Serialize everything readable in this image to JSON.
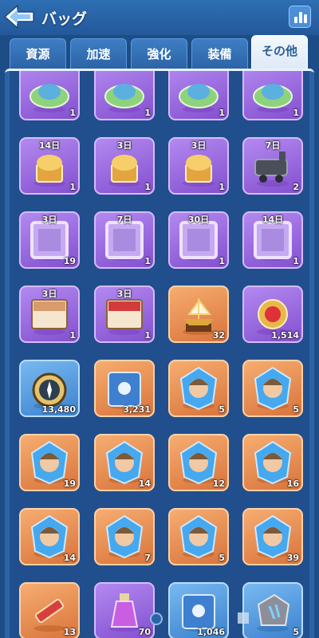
{
  "header": {
    "title": "バッグ",
    "back_icon": "arrow-left-icon",
    "stats_icon": "bar-chart-icon"
  },
  "tabs": [
    {
      "label": "資源",
      "active": false
    },
    {
      "label": "加速",
      "active": false
    },
    {
      "label": "強化",
      "active": false
    },
    {
      "label": "装備",
      "active": false
    },
    {
      "label": "その他",
      "active": true
    }
  ],
  "items": [
    {
      "name": "island-decor-1",
      "rarity": "purple",
      "count": "1",
      "days": ""
    },
    {
      "name": "island-decor-2",
      "rarity": "purple",
      "count": "1",
      "days": ""
    },
    {
      "name": "island-decor-3",
      "rarity": "purple",
      "count": "1",
      "days": ""
    },
    {
      "name": "island-decor-4",
      "rarity": "purple",
      "count": "1",
      "days": ""
    },
    {
      "name": "trophy-chest-1",
      "rarity": "purple",
      "count": "1",
      "days": "14日"
    },
    {
      "name": "trophy-chest-2",
      "rarity": "purple",
      "count": "1",
      "days": "3日"
    },
    {
      "name": "treasure-barrel",
      "rarity": "purple",
      "count": "1",
      "days": "3日"
    },
    {
      "name": "locomotive",
      "rarity": "purple",
      "count": "2",
      "days": "7日"
    },
    {
      "name": "frame-skull",
      "rarity": "purple",
      "count": "19",
      "days": "3日"
    },
    {
      "name": "frame-wings",
      "rarity": "purple",
      "count": "1",
      "days": "7日"
    },
    {
      "name": "frame-flowers",
      "rarity": "purple",
      "count": "1",
      "days": "30日"
    },
    {
      "name": "frame-ice",
      "rarity": "purple",
      "count": "1",
      "days": "14日"
    },
    {
      "name": "scroll-brown",
      "rarity": "purple",
      "count": "1",
      "days": "3日"
    },
    {
      "name": "scroll-red",
      "rarity": "purple",
      "count": "1",
      "days": "3日"
    },
    {
      "name": "ship-trophy",
      "rarity": "orange",
      "count": "32",
      "days": ""
    },
    {
      "name": "ruby-medal",
      "rarity": "purple",
      "count": "1,514",
      "days": ""
    },
    {
      "name": "compass",
      "rarity": "blue",
      "count": "13,480",
      "days": ""
    },
    {
      "name": "blue-book",
      "rarity": "orange",
      "count": "3,231",
      "days": ""
    },
    {
      "name": "hero-crystal-1",
      "rarity": "orange",
      "count": "5",
      "days": ""
    },
    {
      "name": "hero-crystal-2",
      "rarity": "orange",
      "count": "5",
      "days": ""
    },
    {
      "name": "hero-crystal-3",
      "rarity": "orange",
      "count": "19",
      "days": ""
    },
    {
      "name": "hero-crystal-4",
      "rarity": "orange",
      "count": "14",
      "days": ""
    },
    {
      "name": "hero-crystal-5",
      "rarity": "orange",
      "count": "12",
      "days": ""
    },
    {
      "name": "hero-crystal-6",
      "rarity": "orange",
      "count": "16",
      "days": ""
    },
    {
      "name": "hero-crystal-7",
      "rarity": "orange",
      "count": "14",
      "days": ""
    },
    {
      "name": "hero-crystal-8",
      "rarity": "orange",
      "count": "7",
      "days": ""
    },
    {
      "name": "hero-crystal-9",
      "rarity": "orange",
      "count": "5",
      "days": ""
    },
    {
      "name": "hero-crystal-10",
      "rarity": "orange",
      "count": "39",
      "days": ""
    },
    {
      "name": "syringe",
      "rarity": "orange",
      "count": "13",
      "days": ""
    },
    {
      "name": "potion",
      "rarity": "purple",
      "count": "70",
      "days": ""
    },
    {
      "name": "paw-book",
      "rarity": "blue",
      "count": "1,046",
      "days": ""
    },
    {
      "name": "claw-stone",
      "rarity": "blue",
      "count": "5",
      "days": ""
    }
  ],
  "colors": {
    "purple": "#9a68e0",
    "orange": "#e88c50",
    "blue": "#5a9ee0",
    "background": "#1d4d86"
  }
}
